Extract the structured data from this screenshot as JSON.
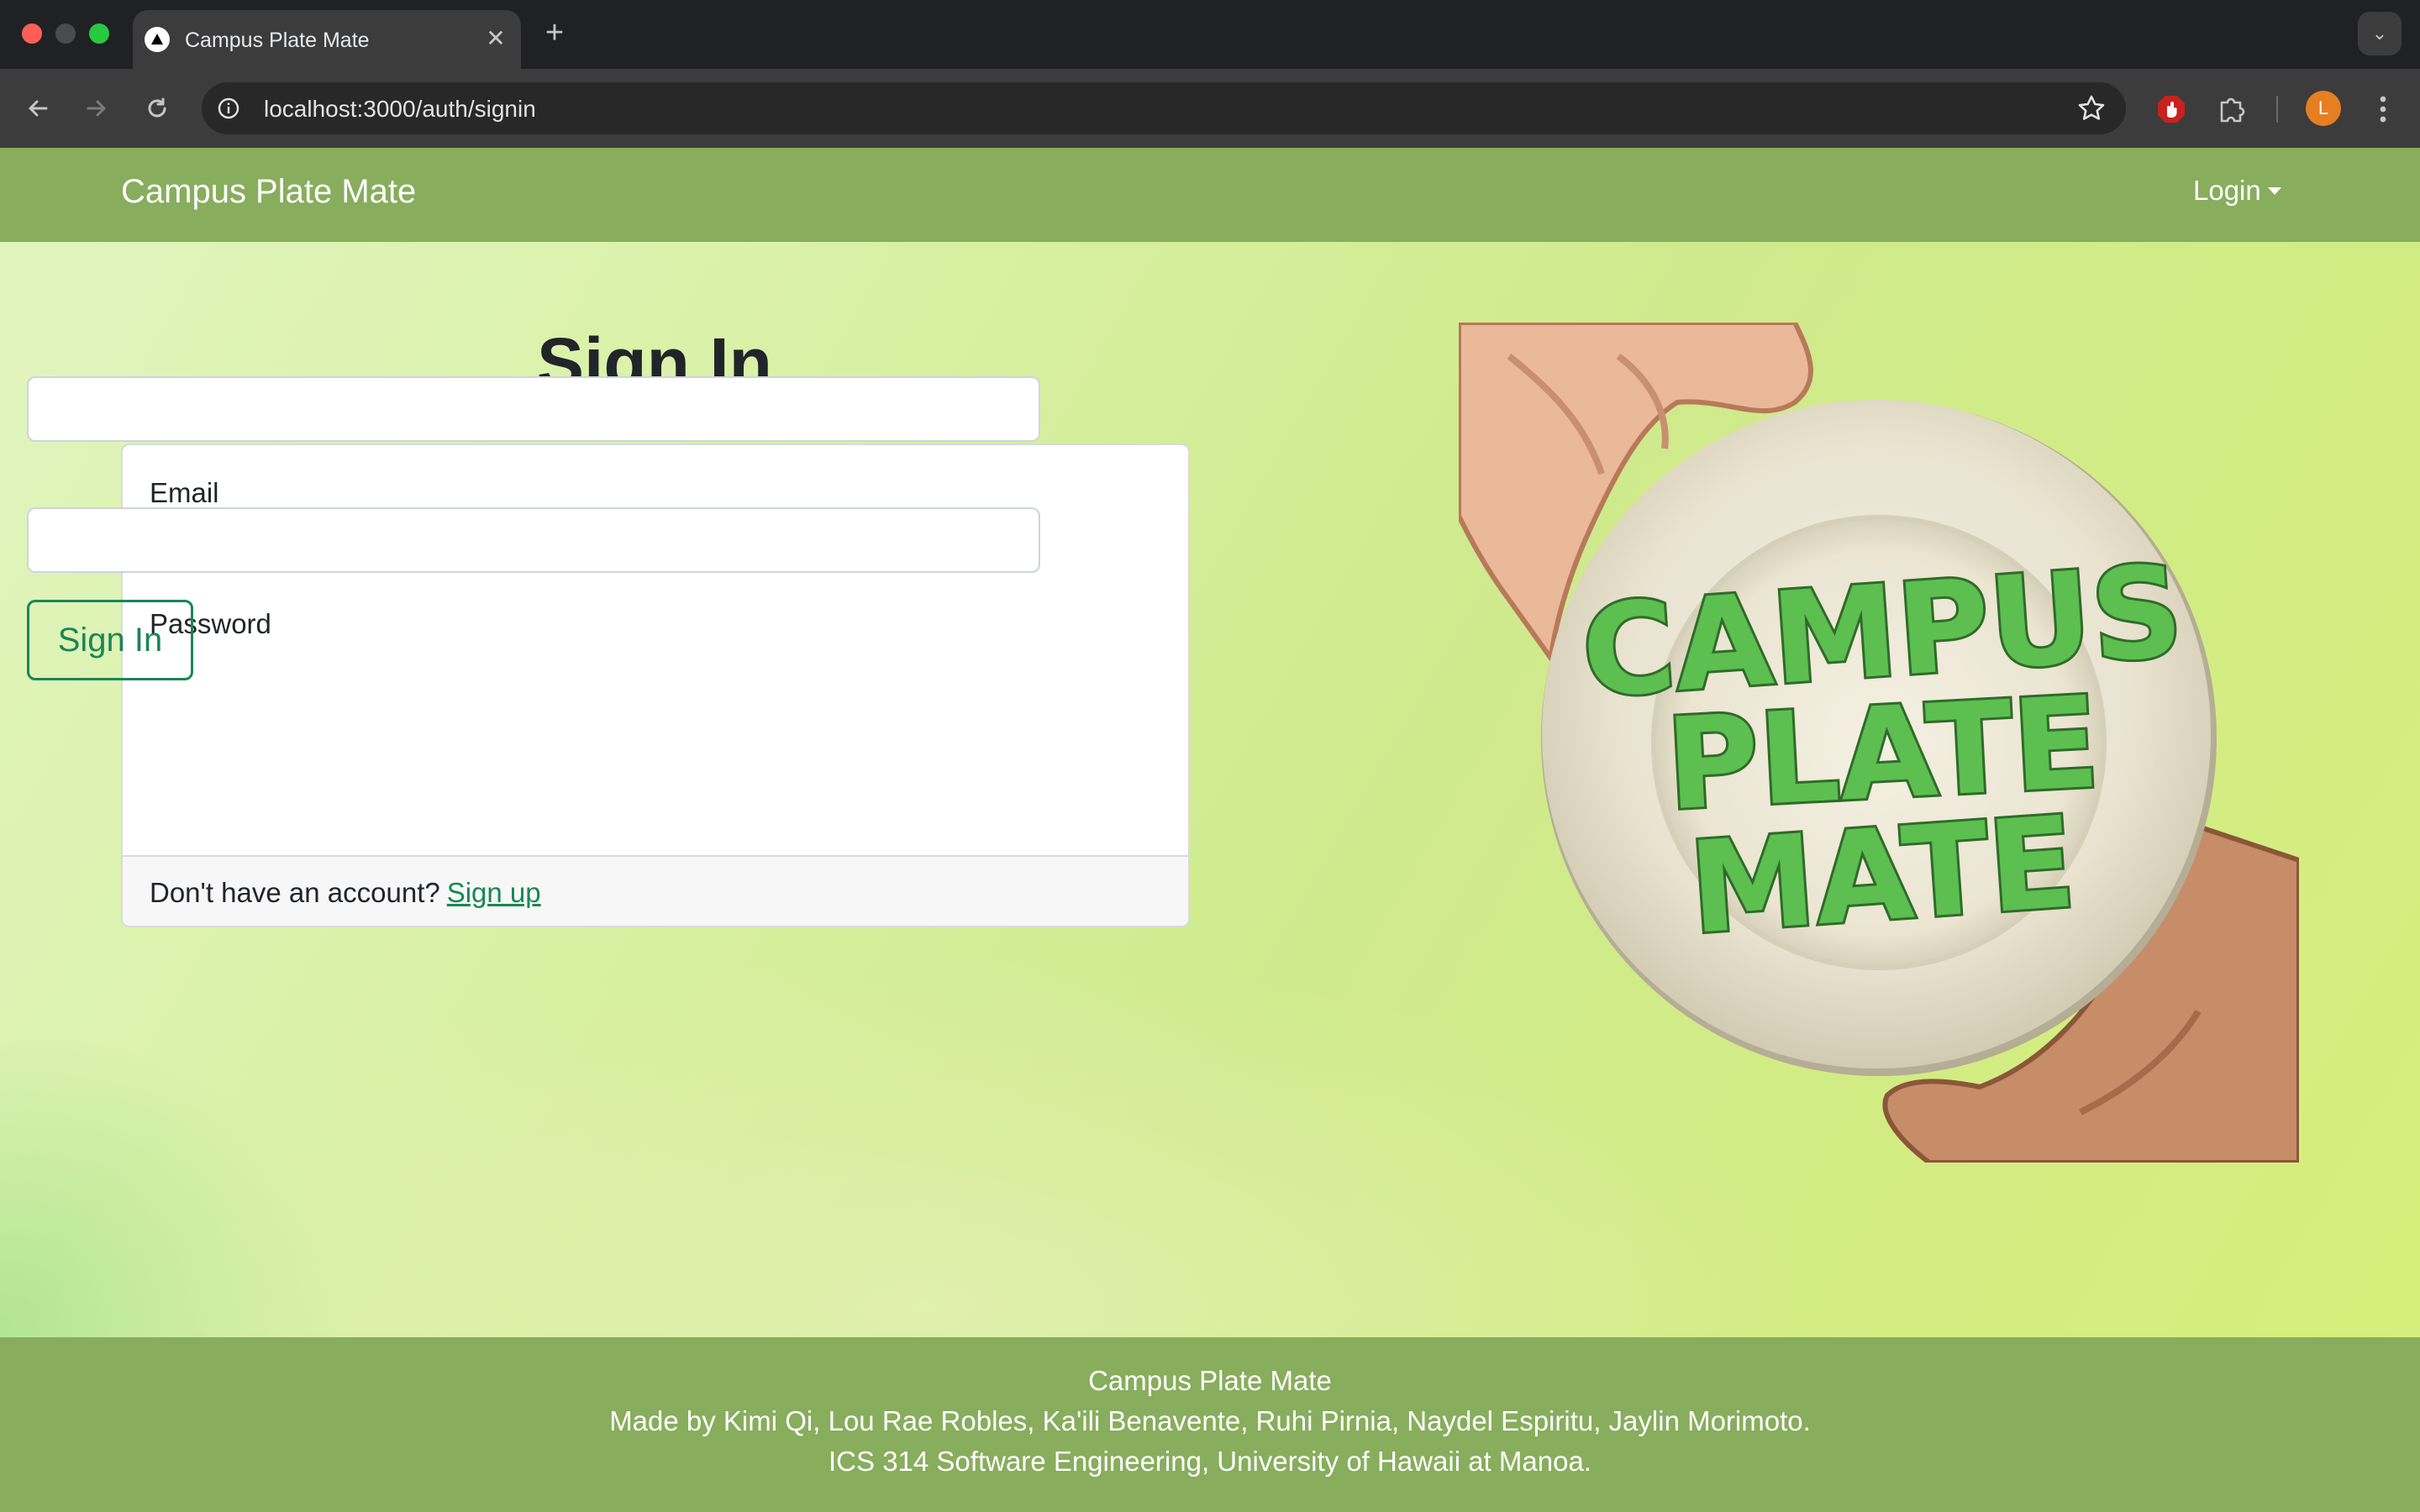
{
  "browser": {
    "tab_title": "Campus Plate Mate",
    "url": "localhost:3000/auth/signin",
    "profile_initial": "L"
  },
  "navbar": {
    "brand": "Campus Plate Mate",
    "login_label": "Login"
  },
  "signin": {
    "title": "Sign In",
    "email_label": "Email",
    "email_value": "",
    "password_label": "Password",
    "password_value": "",
    "submit_label": "Sign In",
    "footer_prompt": "Don't have an account?",
    "signup_link": "Sign up"
  },
  "hero": {
    "logo_lines": [
      "CAMPUS",
      "PLATE",
      "MATE"
    ]
  },
  "footer": {
    "line1": "Campus Plate Mate",
    "line2": "Made by Kimi Qi, Lou Rae Robles, Ka'ili Benavente, Ruhi Pirnia, Naydel Espiritu, Jaylin Morimoto.",
    "line3": "ICS 314 Software Engineering, University of Hawaii at Manoa."
  },
  "colors": {
    "navbar_bg": "#88ad5d",
    "success": "#198754",
    "logo_green": "#5cbf4f"
  },
  "icons": [
    "back-icon",
    "forward-icon",
    "reload-icon",
    "site-info-icon",
    "bookmark-star-icon",
    "adblock-icon",
    "extensions-puzzle-icon",
    "more-menu-icon",
    "tab-search-icon",
    "close-icon",
    "new-tab-icon"
  ]
}
